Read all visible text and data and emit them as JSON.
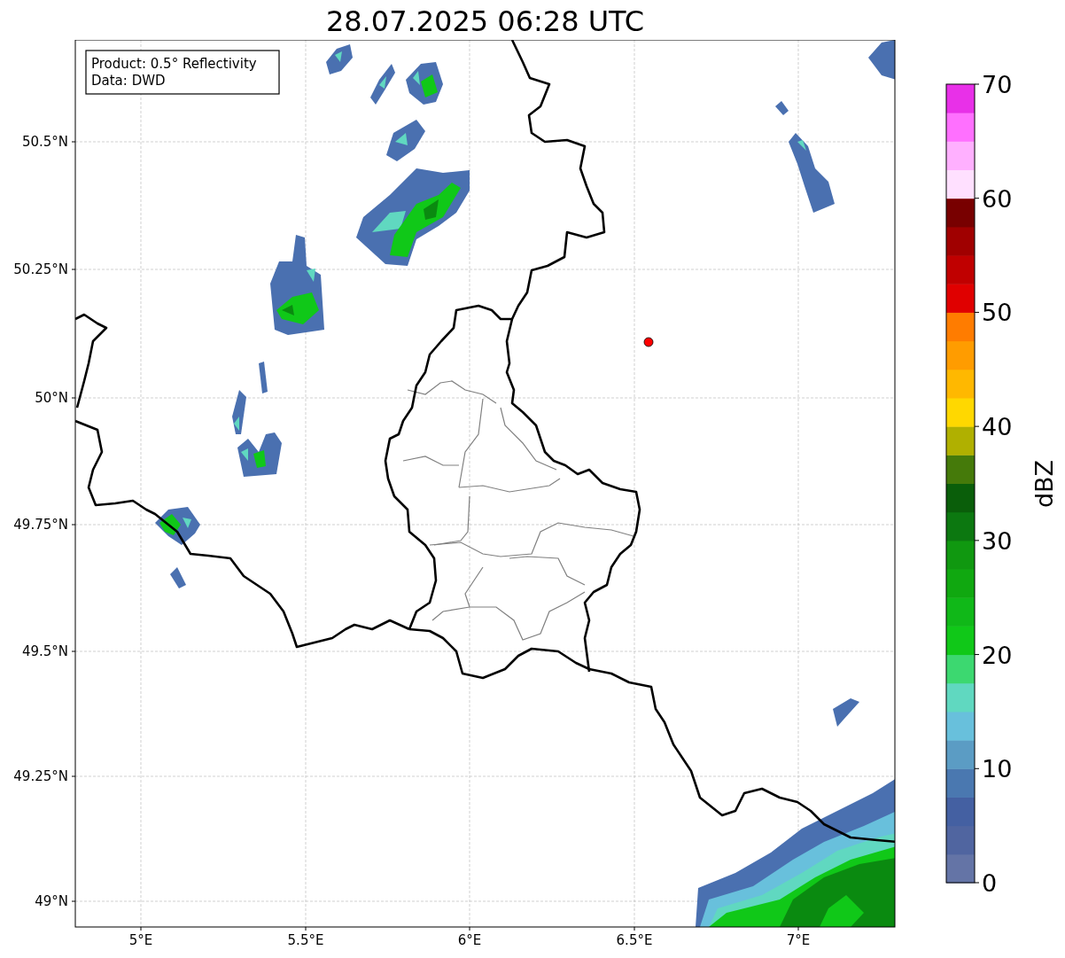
{
  "title": "28.07.2025 06:28 UTC",
  "info_box": {
    "lines": [
      "Product: 0.5° Reflectivity",
      "Data: DWD"
    ]
  },
  "map": {
    "x_ticks": [
      "5°E",
      "5.5°E",
      "6°E",
      "6.5°E",
      "7°E"
    ],
    "y_ticks": [
      "50.5°N",
      "50.25°N",
      "50°N",
      "49.75°N",
      "49.5°N",
      "49.25°N",
      "49°N"
    ]
  },
  "colorbar": {
    "label": "dBZ",
    "ticks": [
      "70",
      "60",
      "50",
      "40",
      "30",
      "20",
      "10",
      "0"
    ],
    "bands": [
      {
        "color": "#6474a6"
      },
      {
        "color": "#5065a0"
      },
      {
        "color": "#4460a2"
      },
      {
        "color": "#4a78b0"
      },
      {
        "color": "#5b9cc4"
      },
      {
        "color": "#68c0dc"
      },
      {
        "color": "#60d8c0"
      },
      {
        "color": "#3cd870"
      },
      {
        "color": "#10c818"
      },
      {
        "color": "#10b818"
      },
      {
        "color": "#10a810"
      },
      {
        "color": "#109810"
      },
      {
        "color": "#0c7810"
      },
      {
        "color": "#0a5e0a"
      },
      {
        "color": "#457a0a"
      },
      {
        "color": "#b0b000"
      },
      {
        "color": "#ffd800"
      },
      {
        "color": "#ffb800"
      },
      {
        "color": "#ff9c00"
      },
      {
        "color": "#ff7c00"
      },
      {
        "color": "#e00000"
      },
      {
        "color": "#c00000"
      },
      {
        "color": "#a00000"
      },
      {
        "color": "#780000"
      },
      {
        "color": "#ffe0ff"
      },
      {
        "color": "#ffb0ff"
      },
      {
        "color": "#ff70ff"
      },
      {
        "color": "#e830e8"
      }
    ]
  }
}
